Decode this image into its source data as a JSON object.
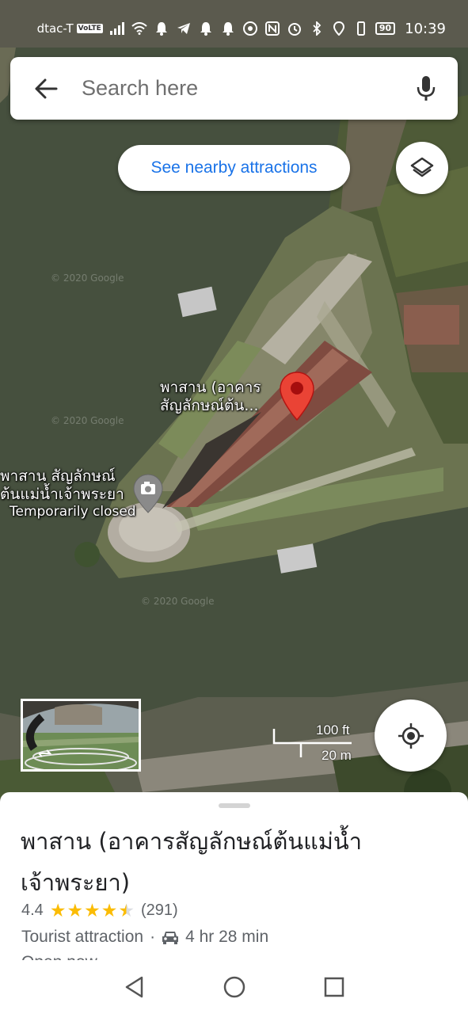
{
  "status_bar": {
    "carrier": "dtac-T",
    "volte": "VoLTE",
    "battery": "90",
    "time": "10:39"
  },
  "search": {
    "placeholder": "Search here"
  },
  "chip": {
    "nearby_label": "See nearby attractions"
  },
  "map": {
    "main_label_line1": "พาสาน (อาคาร",
    "main_label_line2": "สัญลักษณ์ต้น...",
    "second_label_line1": "พาสาน สัญลักษณ์",
    "second_label_line2": "ต้นแม่น้ำเจ้าพระยา",
    "second_label_status": "Temporarily closed",
    "watermark": "© 2020 Google",
    "scale_ft": "100 ft",
    "scale_m": "20 m"
  },
  "place": {
    "title": "พาสาน (อาคารสัญลักษณ์ต้นแม่น้ำเจ้าพระยา)",
    "rating": "4.4",
    "reviews": "(291)",
    "category": "Tourist attraction",
    "separator": "·",
    "drive_time": "4 hr 28 min",
    "open_status": "Open now"
  },
  "colors": {
    "accent": "#1a73e8",
    "pin": "#ea4335",
    "star": "#fbbc04"
  },
  "icons": {
    "back": "arrow-left-icon",
    "mic": "microphone-icon",
    "layers": "layers-icon",
    "locate": "my-location-icon",
    "car": "car-icon"
  }
}
